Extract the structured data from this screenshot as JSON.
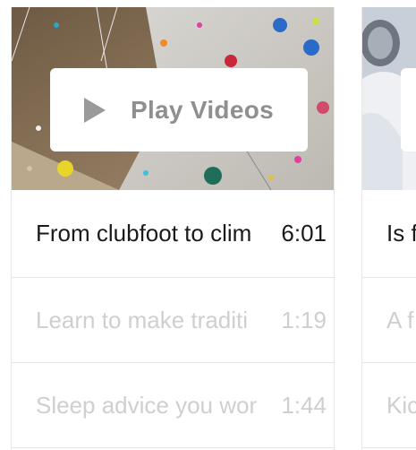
{
  "colors": {
    "active_text": "#1a1a1a",
    "inactive_text": "#cfcfcf",
    "play_icon": "#9a9a9a",
    "divider": "#e6e6e6"
  },
  "cards": [
    {
      "play_label": "Play Videos",
      "play_icon": "play-triangle-icon",
      "items": [
        {
          "title": "From clubfoot to clim",
          "duration": "6:01",
          "active": true
        },
        {
          "title": "Learn to make traditi",
          "duration": "1:19",
          "active": false
        },
        {
          "title": "Sleep advice you wor",
          "duration": "1:44",
          "active": false
        }
      ]
    },
    {
      "items": [
        {
          "title": "Is f",
          "active": true
        },
        {
          "title": "A f",
          "active": false
        },
        {
          "title": "Kic",
          "active": false
        }
      ]
    }
  ]
}
